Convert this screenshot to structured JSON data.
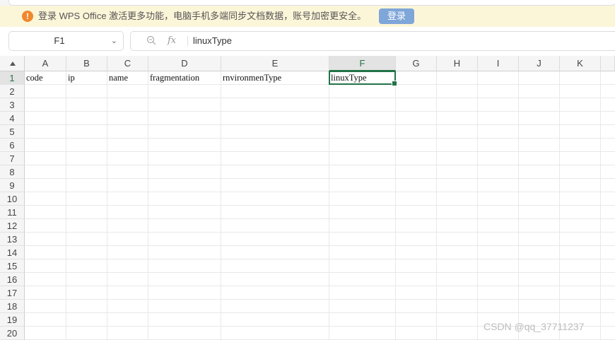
{
  "banner": {
    "message": "登录 WPS Office 激活更多功能，电脑手机多端同步文档数据，账号加密更安全。",
    "login_label": "登录",
    "warn_icon": "!"
  },
  "toolbar": {
    "name_box_value": "F1",
    "fx_label": "fx",
    "formula_value": "linuxType"
  },
  "sheet": {
    "columns": [
      "A",
      "B",
      "C",
      "D",
      "E",
      "F",
      "G",
      "H",
      "I",
      "J",
      "K"
    ],
    "rows": [
      "1",
      "2",
      "3",
      "4",
      "5",
      "6",
      "7",
      "8",
      "9",
      "10",
      "11",
      "12",
      "13",
      "14",
      "15",
      "16",
      "17",
      "18",
      "19",
      "20"
    ],
    "selected_column": "F",
    "selected_row": "1",
    "row1_values": [
      "code",
      "ip",
      "name",
      "fragmentation",
      "rnvironmenType",
      "linuxType"
    ]
  },
  "watermark": "CSDN @qq_37711237"
}
